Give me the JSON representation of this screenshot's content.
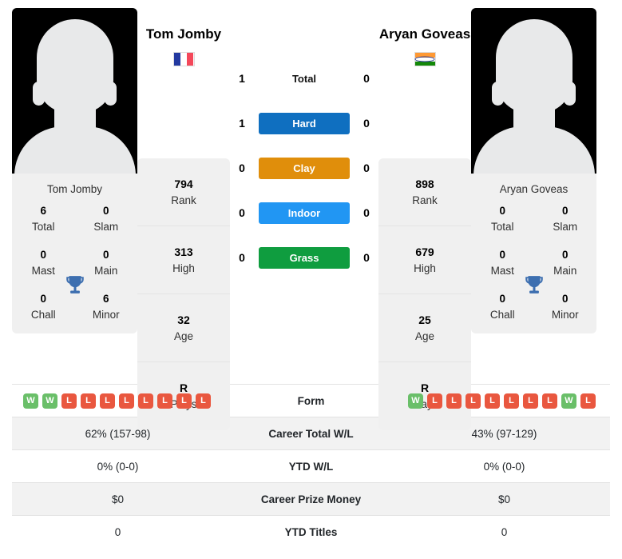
{
  "players": {
    "left": {
      "name": "Tom Jomby",
      "caption": "Tom Jomby",
      "flag": "france-flag",
      "rank": "794",
      "rank_label": "Rank",
      "high": "313",
      "high_label": "High",
      "age": "32",
      "age_label": "Age",
      "plays": "R",
      "plays_label": "Plays",
      "titles": [
        {
          "num": "6",
          "label": "Total"
        },
        {
          "num": "0",
          "label": "Slam"
        },
        {
          "num": "0",
          "label": "Mast"
        },
        {
          "num": "0",
          "label": "Main"
        },
        {
          "num": "0",
          "label": "Chall"
        },
        {
          "num": "6",
          "label": "Minor"
        }
      ],
      "form": [
        "W",
        "W",
        "L",
        "L",
        "L",
        "L",
        "L",
        "L",
        "L",
        "L"
      ],
      "career_wl": "62% (157-98)",
      "ytd_wl": "0% (0-0)",
      "prize_money": "$0",
      "ytd_titles": "0"
    },
    "right": {
      "name": "Aryan Goveas",
      "caption": "Aryan Goveas",
      "flag": "india-flag",
      "rank": "898",
      "rank_label": "Rank",
      "high": "679",
      "high_label": "High",
      "age": "25",
      "age_label": "Age",
      "plays": "R",
      "plays_label": "Plays",
      "titles": [
        {
          "num": "0",
          "label": "Total"
        },
        {
          "num": "0",
          "label": "Slam"
        },
        {
          "num": "0",
          "label": "Mast"
        },
        {
          "num": "0",
          "label": "Main"
        },
        {
          "num": "0",
          "label": "Chall"
        },
        {
          "num": "0",
          "label": "Minor"
        }
      ],
      "form": [
        "W",
        "L",
        "L",
        "L",
        "L",
        "L",
        "L",
        "L",
        "W",
        "L"
      ],
      "career_wl": "43% (97-129)",
      "ytd_wl": "0% (0-0)",
      "prize_money": "$0",
      "ytd_titles": "0"
    }
  },
  "head_to_head": {
    "total": {
      "label": "Total",
      "left": "1",
      "right": "0"
    },
    "surfaces": [
      {
        "label": "Hard",
        "left": "1",
        "right": "0",
        "color": "#0f6fc0"
      },
      {
        "label": "Clay",
        "left": "0",
        "right": "0",
        "color": "#e08e0b"
      },
      {
        "label": "Indoor",
        "left": "0",
        "right": "0",
        "color": "#2196f3"
      },
      {
        "label": "Grass",
        "left": "0",
        "right": "0",
        "color": "#0f9d3f"
      }
    ]
  },
  "table": {
    "rows": [
      {
        "label": "Form",
        "key": "form"
      },
      {
        "label": "Career Total W/L",
        "key": "career_wl"
      },
      {
        "label": "YTD W/L",
        "key": "ytd_wl"
      },
      {
        "label": "Career Prize Money",
        "key": "prize_money"
      },
      {
        "label": "YTD Titles",
        "key": "ytd_titles"
      }
    ]
  },
  "colors": {
    "win": "#6abf69",
    "loss": "#e9573f",
    "trophy": "#3d6fb0",
    "france_blue": "#2339a0",
    "france_red": "#f4485a",
    "india_saffron": "#ff9933",
    "india_green": "#138808"
  }
}
